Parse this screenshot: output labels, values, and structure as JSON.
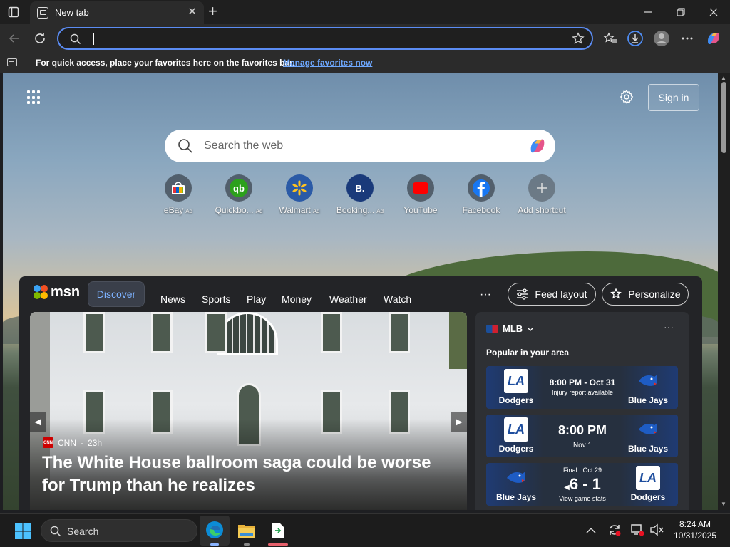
{
  "browser": {
    "tab_title": "New tab",
    "address_value": "",
    "favorites_bar_text": "For quick access, place your favorites here on the favorites bar.",
    "favorites_bar_link": "Manage favorites now",
    "accent_color": "#5b8cf3"
  },
  "newtab": {
    "signin_label": "Sign in",
    "search_placeholder": "Search the web",
    "shortcuts": [
      {
        "label": "eBay",
        "ad": "Ad",
        "icon": "ebay-icon"
      },
      {
        "label": "Quickbo...",
        "ad": "Ad",
        "icon": "quickbooks-icon"
      },
      {
        "label": "Walmart",
        "ad": "Ad",
        "icon": "walmart-icon"
      },
      {
        "label": "Booking...",
        "ad": "Ad",
        "icon": "booking-icon"
      },
      {
        "label": "YouTube",
        "ad": "",
        "icon": "youtube-icon"
      },
      {
        "label": "Facebook",
        "ad": "",
        "icon": "facebook-icon"
      },
      {
        "label": "Add shortcut",
        "ad": "",
        "icon": "plus-icon"
      }
    ]
  },
  "feed": {
    "brand": "msn",
    "tabs": [
      "Discover",
      "News",
      "Sports",
      "Play",
      "Money",
      "Weather",
      "Watch"
    ],
    "more": "···",
    "feed_layout_label": "Feed layout",
    "personalize_label": "Personalize",
    "hero": {
      "source": "CNN",
      "source_logo": "CNN",
      "age": "23h",
      "headline": "The White House ballroom saga could be worse for Trump than he realizes"
    },
    "mlb": {
      "title": "MLB",
      "subtitle": "Popular in your area",
      "games": [
        {
          "left_team": "Dodgers",
          "right_team": "Blue Jays",
          "line1": "8:00 PM - Oct 31",
          "line2": "Injury report available"
        },
        {
          "left_team": "Dodgers",
          "right_team": "Blue Jays",
          "line1": "8:00 PM",
          "line2": "Nov 1"
        },
        {
          "left_team": "Blue Jays",
          "right_team": "Dodgers",
          "status": "Final · Oct 29",
          "score": "6 - 1",
          "footer": "View game stats"
        }
      ]
    }
  },
  "taskbar": {
    "search_label": "Search",
    "time": "8:24 AM",
    "date": "10/31/2025"
  }
}
